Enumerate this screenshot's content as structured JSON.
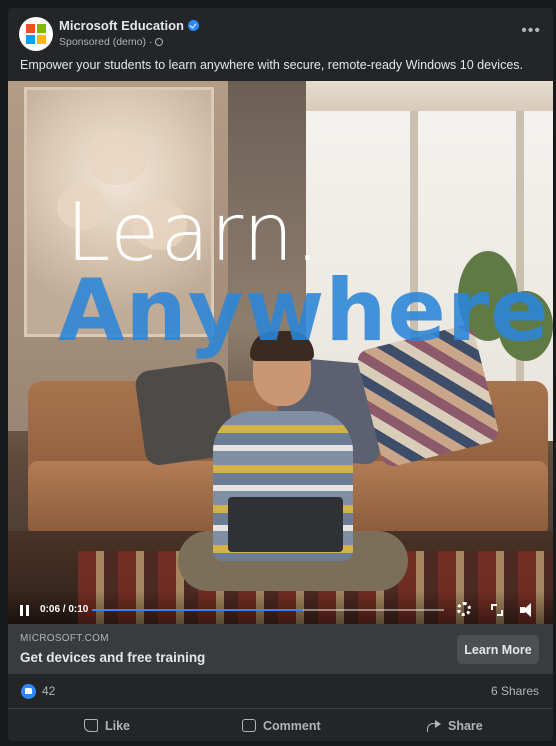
{
  "post": {
    "page_name": "Microsoft Education",
    "sponsored_label": "Sponsored (demo) ·",
    "caption": "Empower your students to learn anywhere with secure, remote-ready Windows 10 devices.",
    "more_label": "•••"
  },
  "logo": {
    "colors": [
      "#f25022",
      "#7fba00",
      "#00a4ef",
      "#ffb900"
    ]
  },
  "video": {
    "headline_line1": "Learn.",
    "headline_line2": "Anywhere.",
    "time": "0:06 / 0:10",
    "progress": 0.6,
    "icons": [
      "pause-icon",
      "settings-icon",
      "fullscreen-icon",
      "volume-icon"
    ]
  },
  "cta": {
    "domain": "MICROSOFT.COM",
    "title": "Get devices and free training",
    "button_label": "Learn More"
  },
  "engagement": {
    "like_count": "42",
    "shares": "6 Shares"
  },
  "actions": {
    "like": "Like",
    "comment": "Comment",
    "share": "Share"
  },
  "colors": {
    "accent": "#2d88ff",
    "headline_blue": "#2b86d9",
    "card_bg": "#242526",
    "page_bg": "#18191a"
  }
}
